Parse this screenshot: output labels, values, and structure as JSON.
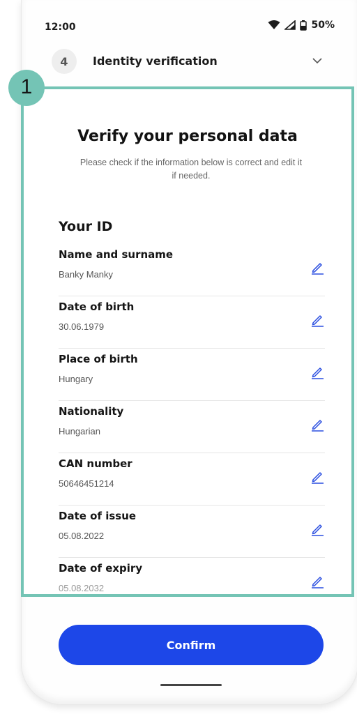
{
  "status_bar": {
    "time": "12:00",
    "battery": "50%"
  },
  "step": {
    "number": "4",
    "title": "Identity verification"
  },
  "callout": {
    "number": "1"
  },
  "main": {
    "title": "Verify your personal data",
    "subtitle": "Please check if the information below is correct and edit it if needed.",
    "section_title": "Your ID",
    "fields": [
      {
        "label": "Name and surname",
        "value": "Banky Manky"
      },
      {
        "label": "Date of birth",
        "value": "30.06.1979"
      },
      {
        "label": "Place of birth",
        "value": "Hungary"
      },
      {
        "label": "Nationality",
        "value": "Hungarian"
      },
      {
        "label": "CAN number",
        "value": "50646451214"
      },
      {
        "label": "Date of issue",
        "value": "05.08.2022"
      },
      {
        "label": "Date of expiry",
        "value": "05.08.2032"
      }
    ]
  },
  "confirm": {
    "label": "Confirm"
  },
  "colors": {
    "accent": "#1d47e8",
    "highlight": "#74c4b5",
    "edit_icon": "#2a4ee0"
  }
}
